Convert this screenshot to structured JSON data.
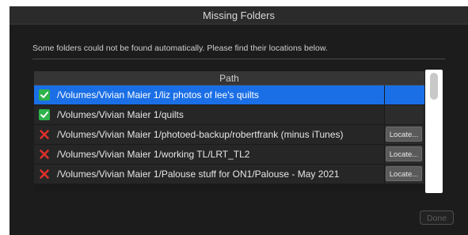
{
  "window": {
    "title": "Missing Folders"
  },
  "message": "Some folders could not be found automatically. Please find their locations below.",
  "table": {
    "header": "Path",
    "rows": [
      {
        "status": "found",
        "path": "/Volumes/Vivian Maier 1/liz photos of lee's quilts",
        "action": "",
        "selected": true
      },
      {
        "status": "found",
        "path": "/Volumes/Vivian Maier 1/quilts",
        "action": "",
        "selected": false
      },
      {
        "status": "missing",
        "path": "/Volumes/Vivian Maier 1/photoed-backup/robertfrank (minus iTunes)",
        "action": "Locate...",
        "selected": false
      },
      {
        "status": "missing",
        "path": "/Volumes/Vivian Maier 1/working TL/LRT_TL2",
        "action": "Locate...",
        "selected": false
      },
      {
        "status": "missing",
        "path": "/Volumes/Vivian Maier 1/Palouse stuff for ON1/Palouse - May 2021",
        "action": "Locate...",
        "selected": false
      }
    ]
  },
  "footer": {
    "done_label": "Done"
  },
  "colors": {
    "selection": "#1b6fe6",
    "found": "#2db34a",
    "missing": "#e0302a"
  },
  "icons": {
    "found": "checkmark-icon",
    "missing": "x-mark-icon"
  }
}
